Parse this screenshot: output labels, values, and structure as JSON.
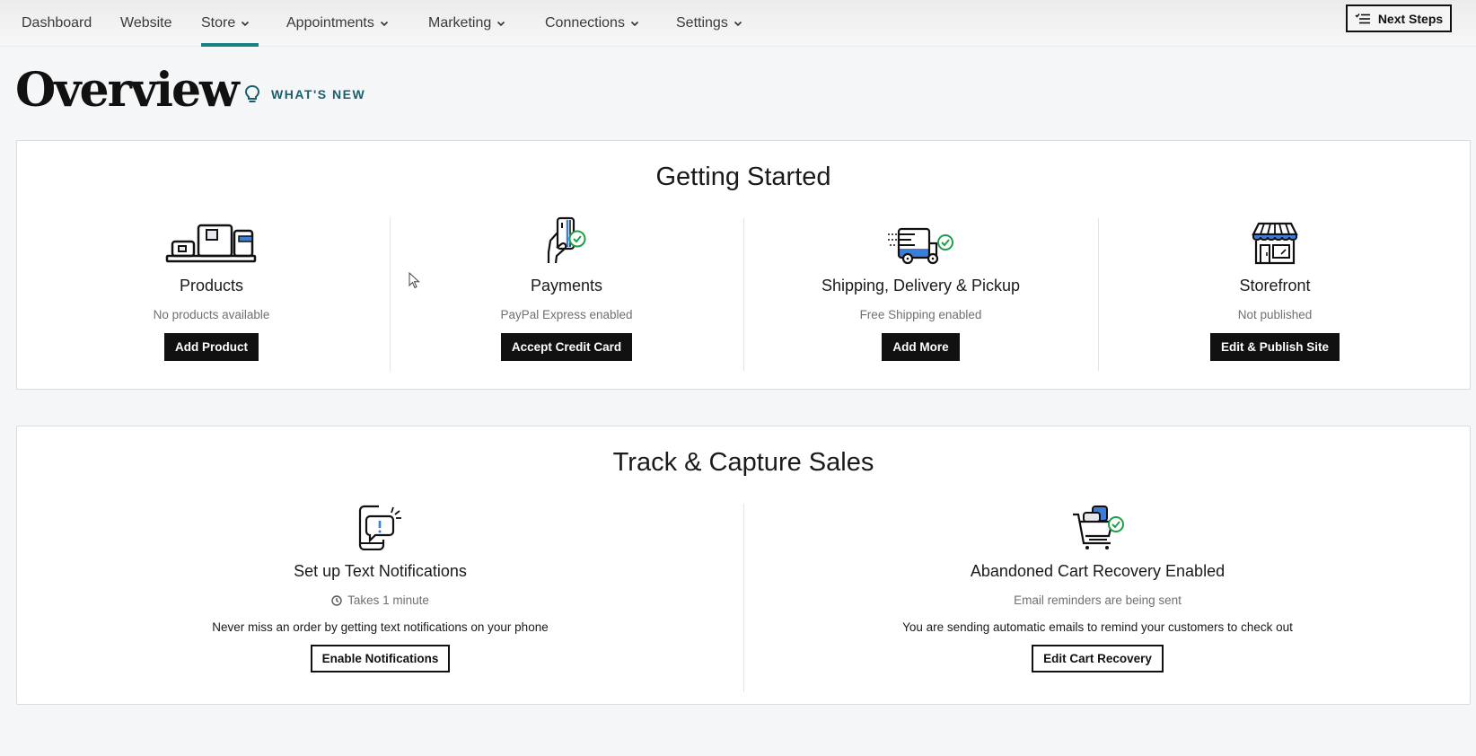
{
  "nav": {
    "items": [
      {
        "label": "Dashboard",
        "dropdown": false,
        "active": false
      },
      {
        "label": "Website",
        "dropdown": false,
        "active": false
      },
      {
        "label": "Store",
        "dropdown": true,
        "active": true
      },
      {
        "label": "Appointments",
        "dropdown": true,
        "active": false
      },
      {
        "label": "Marketing",
        "dropdown": true,
        "active": false
      },
      {
        "label": "Connections",
        "dropdown": true,
        "active": false
      },
      {
        "label": "Settings",
        "dropdown": true,
        "active": false
      }
    ],
    "next_steps_label": "Next Steps",
    "accent_color": "#1b7f83"
  },
  "header": {
    "title": "Overview",
    "whats_new_label": "WHAT'S NEW",
    "whats_new_color": "#1b5e6a"
  },
  "getting_started": {
    "title": "Getting Started",
    "items": [
      {
        "icon": "products-icon",
        "title": "Products",
        "status": "No products available",
        "button": "Add Product"
      },
      {
        "icon": "payments-icon",
        "title": "Payments",
        "status": "PayPal Express enabled",
        "button": "Accept Credit Card"
      },
      {
        "icon": "shipping-truck-icon",
        "title": "Shipping, Delivery & Pickup",
        "status": "Free Shipping enabled",
        "button": "Add More"
      },
      {
        "icon": "storefront-icon",
        "title": "Storefront",
        "status": "Not published",
        "button": "Edit & Publish Site"
      }
    ]
  },
  "track_capture": {
    "title": "Track & Capture Sales",
    "items": [
      {
        "icon": "phone-alert-icon",
        "title": "Set up Text Notifications",
        "status": "Takes 1 minute",
        "status_icon": "clock-icon",
        "description": "Never miss an order by getting text notifications on your phone",
        "button": "Enable Notifications"
      },
      {
        "icon": "cart-check-icon",
        "title": "Abandoned Cart Recovery Enabled",
        "status": "Email reminders are being sent",
        "description": "You are sending automatic emails to remind your customers to check out",
        "button": "Edit Cart Recovery"
      }
    ]
  },
  "colors": {
    "icon_blue": "#3b7dd8",
    "check_green": "#1f9e4a",
    "button_dark": "#111111"
  }
}
